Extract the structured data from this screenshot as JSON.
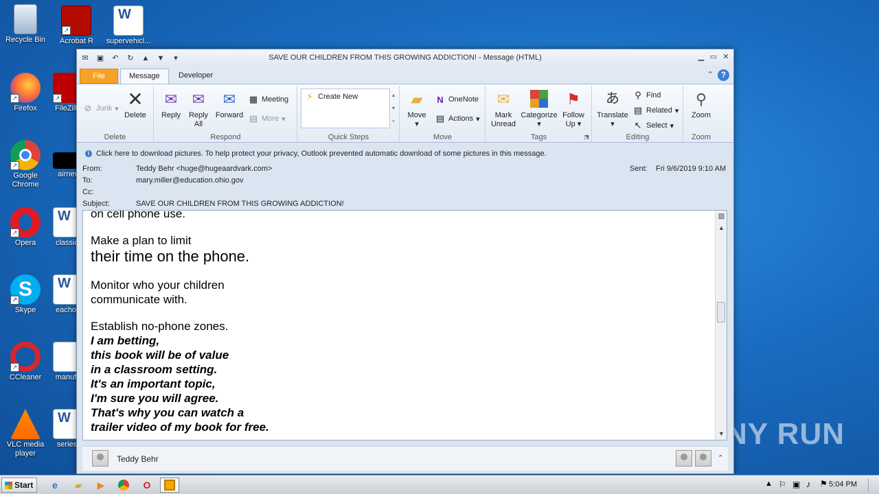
{
  "desktop": {
    "icons": [
      {
        "label": "Recycle Bin",
        "icon": "recycle-bin-icon"
      },
      {
        "label": "Acrobat Reader",
        "icon": "acrobat-icon"
      },
      {
        "label": "supervehicl...",
        "icon": "word-document-icon"
      },
      {
        "label": "Firefox",
        "icon": "firefox-icon"
      },
      {
        "label": "FileZilla",
        "icon": "filezilla-icon"
      },
      {
        "label": "Google Chrome",
        "icon": "chrome-icon"
      },
      {
        "label": "airnev",
        "icon": "file-icon"
      },
      {
        "label": "Opera",
        "icon": "opera-icon"
      },
      {
        "label": "classict",
        "icon": "word-document-icon"
      },
      {
        "label": "Skype",
        "icon": "skype-icon"
      },
      {
        "label": "eachop",
        "icon": "word-document-icon"
      },
      {
        "label": "CCleaner",
        "icon": "ccleaner-icon"
      },
      {
        "label": "manufa",
        "icon": "file-icon"
      },
      {
        "label": "VLC media player",
        "icon": "vlc-icon"
      },
      {
        "label": "seriest",
        "icon": "word-document-icon"
      }
    ]
  },
  "window": {
    "title": "SAVE OUR CHILDREN FROM THIS GROWING ADDICTION!  -  Message (HTML)",
    "tabs": {
      "file": "File",
      "message": "Message",
      "developer": "Developer"
    }
  },
  "ribbon": {
    "delete_group": {
      "junk": "Junk",
      "delete": "Delete",
      "label": "Delete"
    },
    "respond_group": {
      "reply": "Reply",
      "reply_all_1": "Reply",
      "reply_all_2": "All",
      "forward": "Forward",
      "meeting": "Meeting",
      "more": "More",
      "label": "Respond"
    },
    "quick_steps_group": {
      "create_new": "Create New",
      "label": "Quick Steps"
    },
    "move_group": {
      "move": "Move",
      "onenote": "OneNote",
      "actions": "Actions",
      "label": "Move"
    },
    "tags_group": {
      "mark_1": "Mark",
      "mark_2": "Unread",
      "categorize": "Categorize",
      "follow_1": "Follow",
      "follow_2": "Up",
      "label": "Tags"
    },
    "editing_group": {
      "translate": "Translate",
      "find": "Find",
      "related": "Related",
      "select": "Select",
      "label": "Editing"
    },
    "zoom_group": {
      "zoom": "Zoom",
      "label": "Zoom"
    }
  },
  "message": {
    "infobar": "Click here to download pictures. To help protect your privacy, Outlook prevented automatic download of some pictures in this message.",
    "from_label": "From:",
    "from": "Teddy Behr <huge@hugeaardvark.com>",
    "to_label": "To:",
    "to": "mary.miller@education.ohio.gov",
    "cc_label": "Cc:",
    "subject_label": "Subject:",
    "subject": "SAVE OUR CHILDREN FROM THIS GROWING ADDICTION!",
    "sent_label": "Sent:",
    "sent": "Fri 9/6/2019 9:10 AM"
  },
  "body": {
    "line1": "on cell phone use.",
    "line2": "Make a plan to limit",
    "line3": "their time on the phone.",
    "line4": "Monitor who your children",
    "line5": "communicate with.",
    "line6": "Establish no-phone zones.",
    "italic": [
      "I am betting,",
      "this book will be of value",
      "in a classroom setting.",
      "It's an important topic,",
      "I'm sure you will agree.",
      "That's why you can watch a",
      "trailer video of my book for free."
    ]
  },
  "people_pane": {
    "name": "Teddy Behr"
  },
  "taskbar": {
    "start": "Start",
    "clock": "5:04 PM"
  },
  "watermark": "ANY RUN"
}
